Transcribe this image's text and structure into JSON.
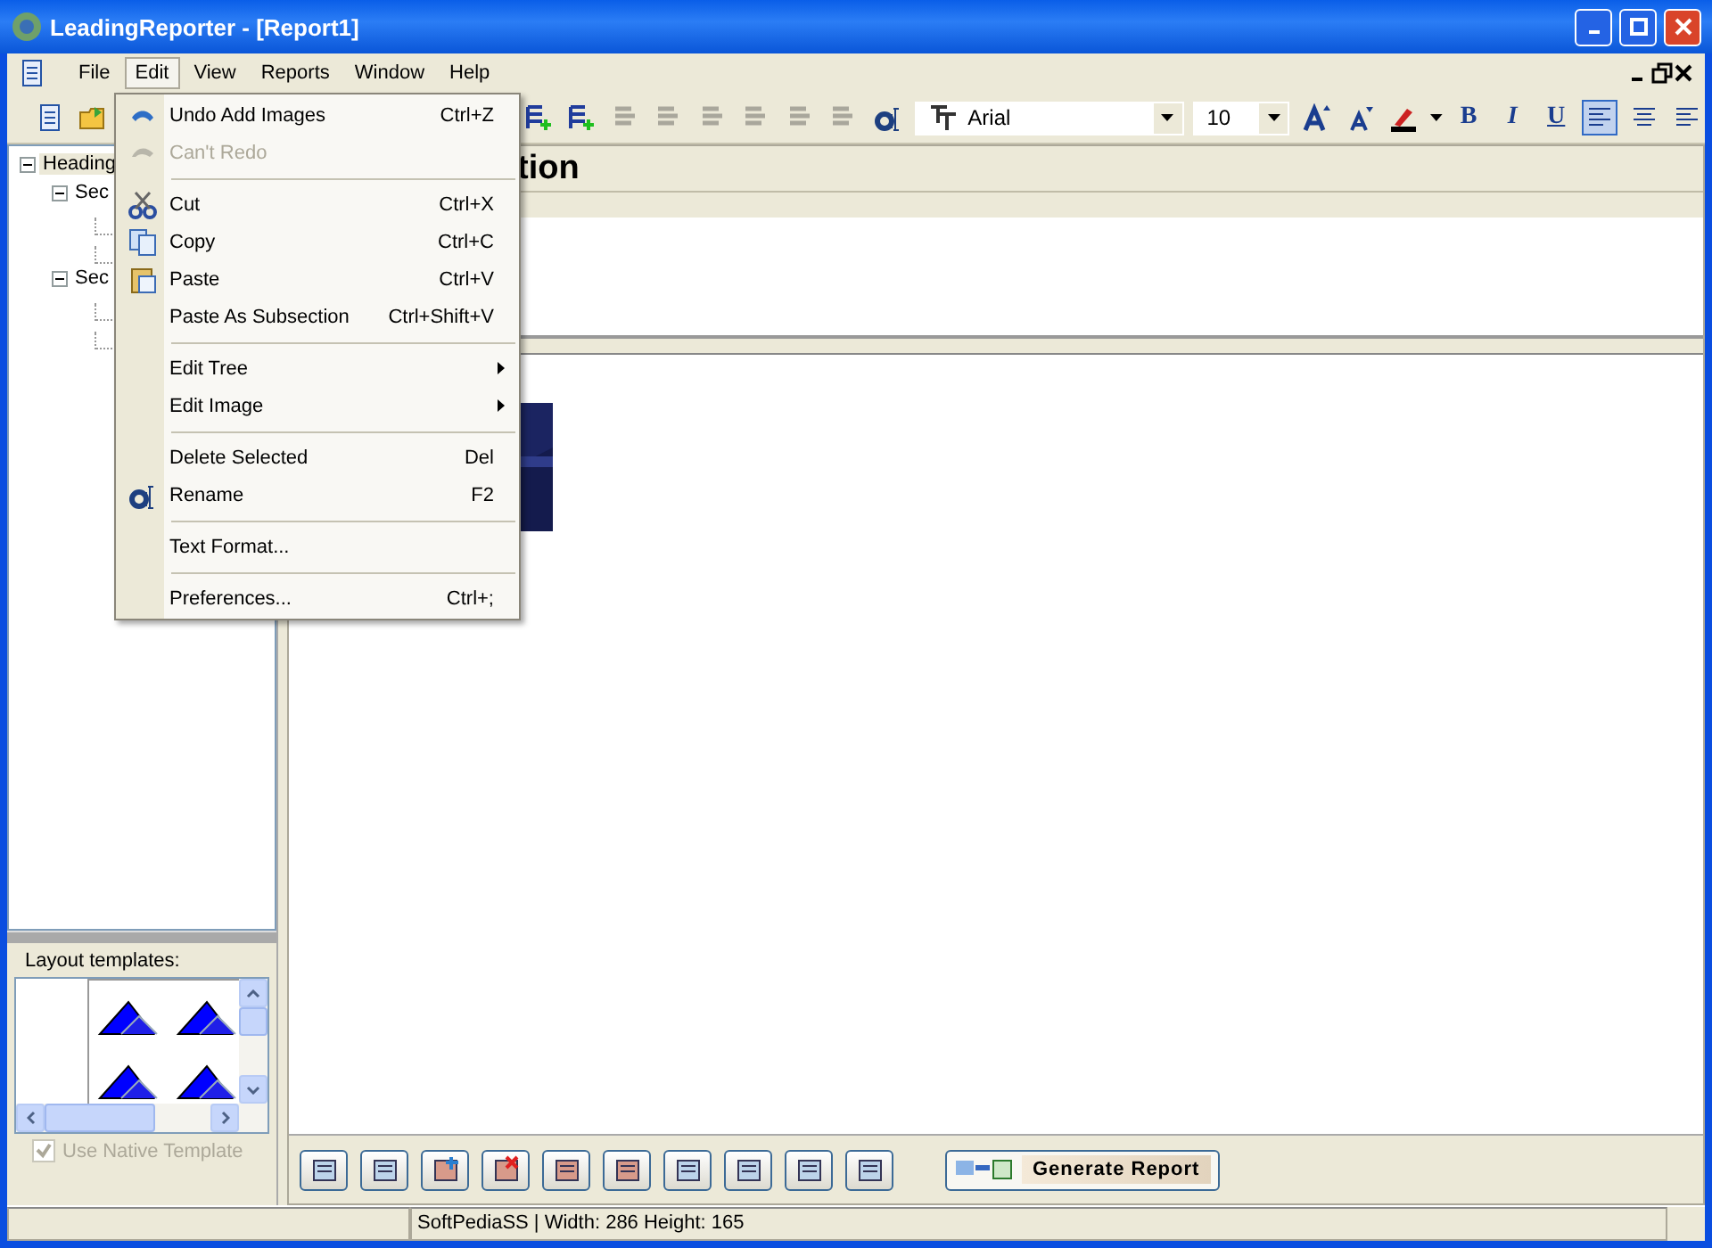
{
  "window": {
    "title": "LeadingReporter - [Report1]"
  },
  "menu_bar": [
    {
      "label": "File",
      "selected": false
    },
    {
      "label": "Edit",
      "selected": true
    },
    {
      "label": "View",
      "selected": false
    },
    {
      "label": "Reports",
      "selected": false
    },
    {
      "label": "Window",
      "selected": false
    },
    {
      "label": "Help",
      "selected": false
    }
  ],
  "edit_menu": [
    {
      "kind": "item",
      "label": "Undo Add Images",
      "shortcut": "Ctrl+Z",
      "disabled": false
    },
    {
      "kind": "item",
      "label": "Can't Redo",
      "disabled": true
    },
    {
      "kind": "separator"
    },
    {
      "kind": "item",
      "label": "Cut",
      "shortcut": "Ctrl+X",
      "disabled": false
    },
    {
      "kind": "item",
      "label": "Copy",
      "shortcut": "Ctrl+C",
      "disabled": false
    },
    {
      "kind": "item",
      "label": "Paste",
      "shortcut": "Ctrl+V",
      "disabled": false
    },
    {
      "kind": "item",
      "label": "Paste As Subsection",
      "shortcut": "Ctrl+Shift+V",
      "disabled": false
    },
    {
      "kind": "separator"
    },
    {
      "kind": "submenu",
      "label": "Edit Tree",
      "disabled": false
    },
    {
      "kind": "submenu",
      "label": "Edit Image",
      "disabled": false
    },
    {
      "kind": "separator"
    },
    {
      "kind": "item",
      "label": "Delete Selected",
      "shortcut": "Del",
      "disabled": false
    },
    {
      "kind": "item",
      "label": "Rename",
      "shortcut": "F2",
      "disabled": false
    },
    {
      "kind": "separator"
    },
    {
      "kind": "item",
      "label": "Text Format...",
      "disabled": false
    },
    {
      "kind": "separator"
    },
    {
      "kind": "item",
      "label": "Preferences...",
      "shortcut": "Ctrl+;",
      "disabled": false
    }
  ],
  "toolbar": {
    "font": "Arial",
    "size": "10",
    "format_buttons": [
      {
        "label": "B"
      },
      {
        "label": "I"
      },
      {
        "label": "U"
      }
    ],
    "align_buttons": [
      {
        "selected": true
      },
      {
        "selected": false
      },
      {
        "selected": false
      }
    ]
  },
  "tree": [
    {
      "label": "Heading",
      "expanded": true,
      "selected": true,
      "children": [
        {
          "label": "Sec",
          "expanded": true,
          "selected": false
        },
        {
          "label": "Sec",
          "expanded": true,
          "selected": false
        }
      ]
    }
  ],
  "heading": {
    "title": "tion"
  },
  "layout_templates": {
    "label": "Layout templates:",
    "use_native_template": {
      "label": "Use Native Template",
      "checked": true,
      "disabled": true
    }
  },
  "generate_button": {
    "label": "Generate Report"
  },
  "status_bar": {
    "text": "SoftPediaSS | Width: 286 Height: 165"
  }
}
